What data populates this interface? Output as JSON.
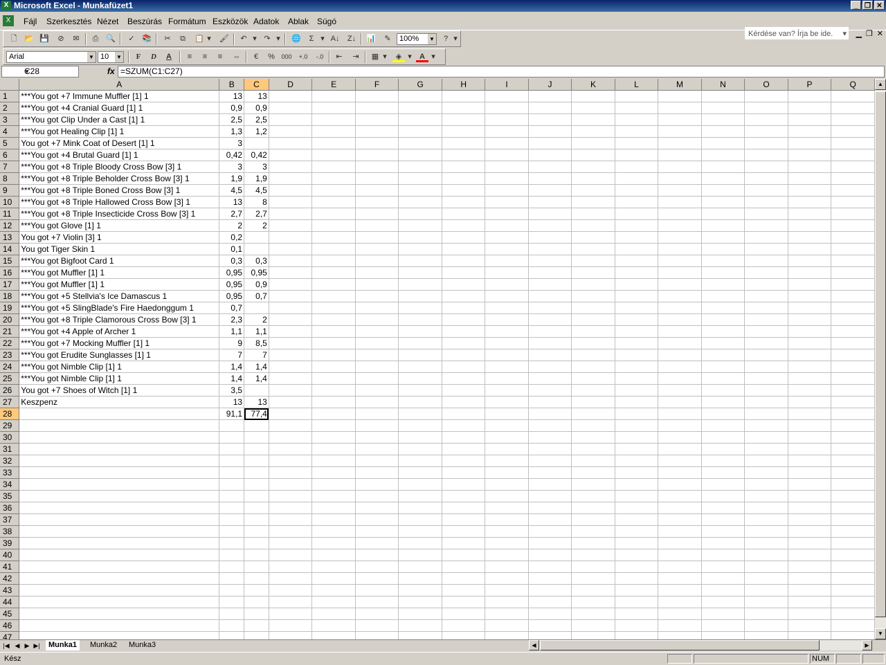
{
  "window": {
    "title": "Microsoft Excel - Munkafüzet1"
  },
  "menu": [
    "Fájl",
    "Szerkesztés",
    "Nézet",
    "Beszúrás",
    "Formátum",
    "Eszközök",
    "Adatok",
    "Ablak",
    "Súgó"
  ],
  "help_box": {
    "placeholder": "Kérdése van? Írja be ide."
  },
  "toolbar": {
    "zoom": "100%",
    "font_name": "Arial",
    "font_size": "10",
    "bold": "F",
    "italic": "D",
    "underline": "A",
    "percent": "%",
    "thousands": "000",
    "sum": "Σ"
  },
  "formula_bar": {
    "name_box": "C28",
    "fx": "fx",
    "formula": "=SZUM(C1:C27)"
  },
  "columns": [
    "A",
    "B",
    "C",
    "D",
    "E",
    "F",
    "G",
    "H",
    "I",
    "J",
    "K",
    "L",
    "M",
    "N",
    "O",
    "P",
    "Q"
  ],
  "selected_column": "C",
  "selected_row": 28,
  "active_cell": "C28",
  "rows": [
    {
      "n": "1",
      "a": "***You got +7 Immune Muffler [1] 1",
      "b": "13",
      "c": "13"
    },
    {
      "n": "2",
      "a": "***You got +4 Cranial Guard [1] 1",
      "b": "0,9",
      "c": "0,9"
    },
    {
      "n": "3",
      "a": "***You got Clip Under a Cast [1] 1",
      "b": "2,5",
      "c": "2,5"
    },
    {
      "n": "4",
      "a": "***You got Healing Clip [1] 1",
      "b": "1,3",
      "c": "1,2"
    },
    {
      "n": "5",
      "a": "You got +7 Mink Coat of Desert [1] 1",
      "b": "3",
      "c": ""
    },
    {
      "n": "6",
      "a": "***You got +4 Brutal Guard [1] 1",
      "b": "0,42",
      "c": "0,42"
    },
    {
      "n": "7",
      "a": "***You got +8 Triple Bloody Cross Bow [3] 1",
      "b": "3",
      "c": "3"
    },
    {
      "n": "8",
      "a": "***You got +8 Triple Beholder Cross Bow [3] 1",
      "b": "1,9",
      "c": "1,9"
    },
    {
      "n": "9",
      "a": "***You got +8 Triple Boned Cross Bow [3] 1",
      "b": "4,5",
      "c": "4,5"
    },
    {
      "n": "10",
      "a": "***You got +8 Triple Hallowed Cross Bow [3] 1",
      "b": "13",
      "c": "8"
    },
    {
      "n": "11",
      "a": "***You got +8 Triple Insecticide Cross Bow [3] 1",
      "b": "2,7",
      "c": "2,7"
    },
    {
      "n": "12",
      "a": "***You got Glove [1] 1",
      "b": "2",
      "c": "2"
    },
    {
      "n": "13",
      "a": "You got +7 Violin [3] 1",
      "b": "0,2",
      "c": ""
    },
    {
      "n": "14",
      "a": "You got Tiger Skin 1",
      "b": "0,1",
      "c": ""
    },
    {
      "n": "15",
      "a": "***You got Bigfoot Card 1",
      "b": "0,3",
      "c": "0,3"
    },
    {
      "n": "16",
      "a": "***You got Muffler [1] 1",
      "b": "0,95",
      "c": "0,95"
    },
    {
      "n": "17",
      "a": "***You got Muffler [1] 1",
      "b": "0,95",
      "c": "0,9"
    },
    {
      "n": "18",
      "a": "***You got +5 Stellvia's Ice Damascus 1",
      "b": "0,95",
      "c": "0,7"
    },
    {
      "n": "19",
      "a": "***You got +5 SlingBlade's Fire Haedonggum 1",
      "b": "0,7",
      "c": ""
    },
    {
      "n": "20",
      "a": "***You got +8 Triple Clamorous Cross Bow [3] 1",
      "b": "2,3",
      "c": "2"
    },
    {
      "n": "21",
      "a": "***You got +4 Apple of Archer 1",
      "b": "1,1",
      "c": "1,1"
    },
    {
      "n": "22",
      "a": "***You got +7 Mocking Muffler [1] 1",
      "b": "9",
      "c": "8,5"
    },
    {
      "n": "23",
      "a": "***You got Erudite Sunglasses [1] 1",
      "b": "7",
      "c": "7"
    },
    {
      "n": "24",
      "a": "***You got Nimble Clip [1] 1",
      "b": "1,4",
      "c": "1,4"
    },
    {
      "n": "25",
      "a": "***You got Nimble Clip [1] 1",
      "b": "1,4",
      "c": "1,4"
    },
    {
      "n": "26",
      "a": "You got +7 Shoes of Witch [1] 1",
      "b": "3,5",
      "c": ""
    },
    {
      "n": "27",
      "a": "Keszpenz",
      "b": "13",
      "c": "13"
    },
    {
      "n": "28",
      "a": "",
      "b": "91,1",
      "c": "77,4"
    },
    {
      "n": "29",
      "a": "",
      "b": "",
      "c": ""
    },
    {
      "n": "30",
      "a": "",
      "b": "",
      "c": ""
    },
    {
      "n": "31",
      "a": "",
      "b": "",
      "c": ""
    },
    {
      "n": "32",
      "a": "",
      "b": "",
      "c": ""
    },
    {
      "n": "33",
      "a": "",
      "b": "",
      "c": ""
    },
    {
      "n": "34",
      "a": "",
      "b": "",
      "c": ""
    },
    {
      "n": "35",
      "a": "",
      "b": "",
      "c": ""
    },
    {
      "n": "36",
      "a": "",
      "b": "",
      "c": ""
    },
    {
      "n": "37",
      "a": "",
      "b": "",
      "c": ""
    },
    {
      "n": "38",
      "a": "",
      "b": "",
      "c": ""
    },
    {
      "n": "39",
      "a": "",
      "b": "",
      "c": ""
    },
    {
      "n": "40",
      "a": "",
      "b": "",
      "c": ""
    },
    {
      "n": "41",
      "a": "",
      "b": "",
      "c": ""
    },
    {
      "n": "42",
      "a": "",
      "b": "",
      "c": ""
    },
    {
      "n": "43",
      "a": "",
      "b": "",
      "c": ""
    },
    {
      "n": "44",
      "a": "",
      "b": "",
      "c": ""
    },
    {
      "n": "45",
      "a": "",
      "b": "",
      "c": ""
    },
    {
      "n": "46",
      "a": "",
      "b": "",
      "c": ""
    },
    {
      "n": "47",
      "a": "",
      "b": "",
      "c": ""
    }
  ],
  "sheet_tabs": [
    "Munka1",
    "Munka2",
    "Munka3"
  ],
  "active_tab": "Munka1",
  "status": {
    "text": "Kész",
    "num": "NUM"
  },
  "colors": {
    "title_bar": "#0a246a",
    "selected_header": "#ffc87c",
    "excel_green": "#1e7b34"
  }
}
